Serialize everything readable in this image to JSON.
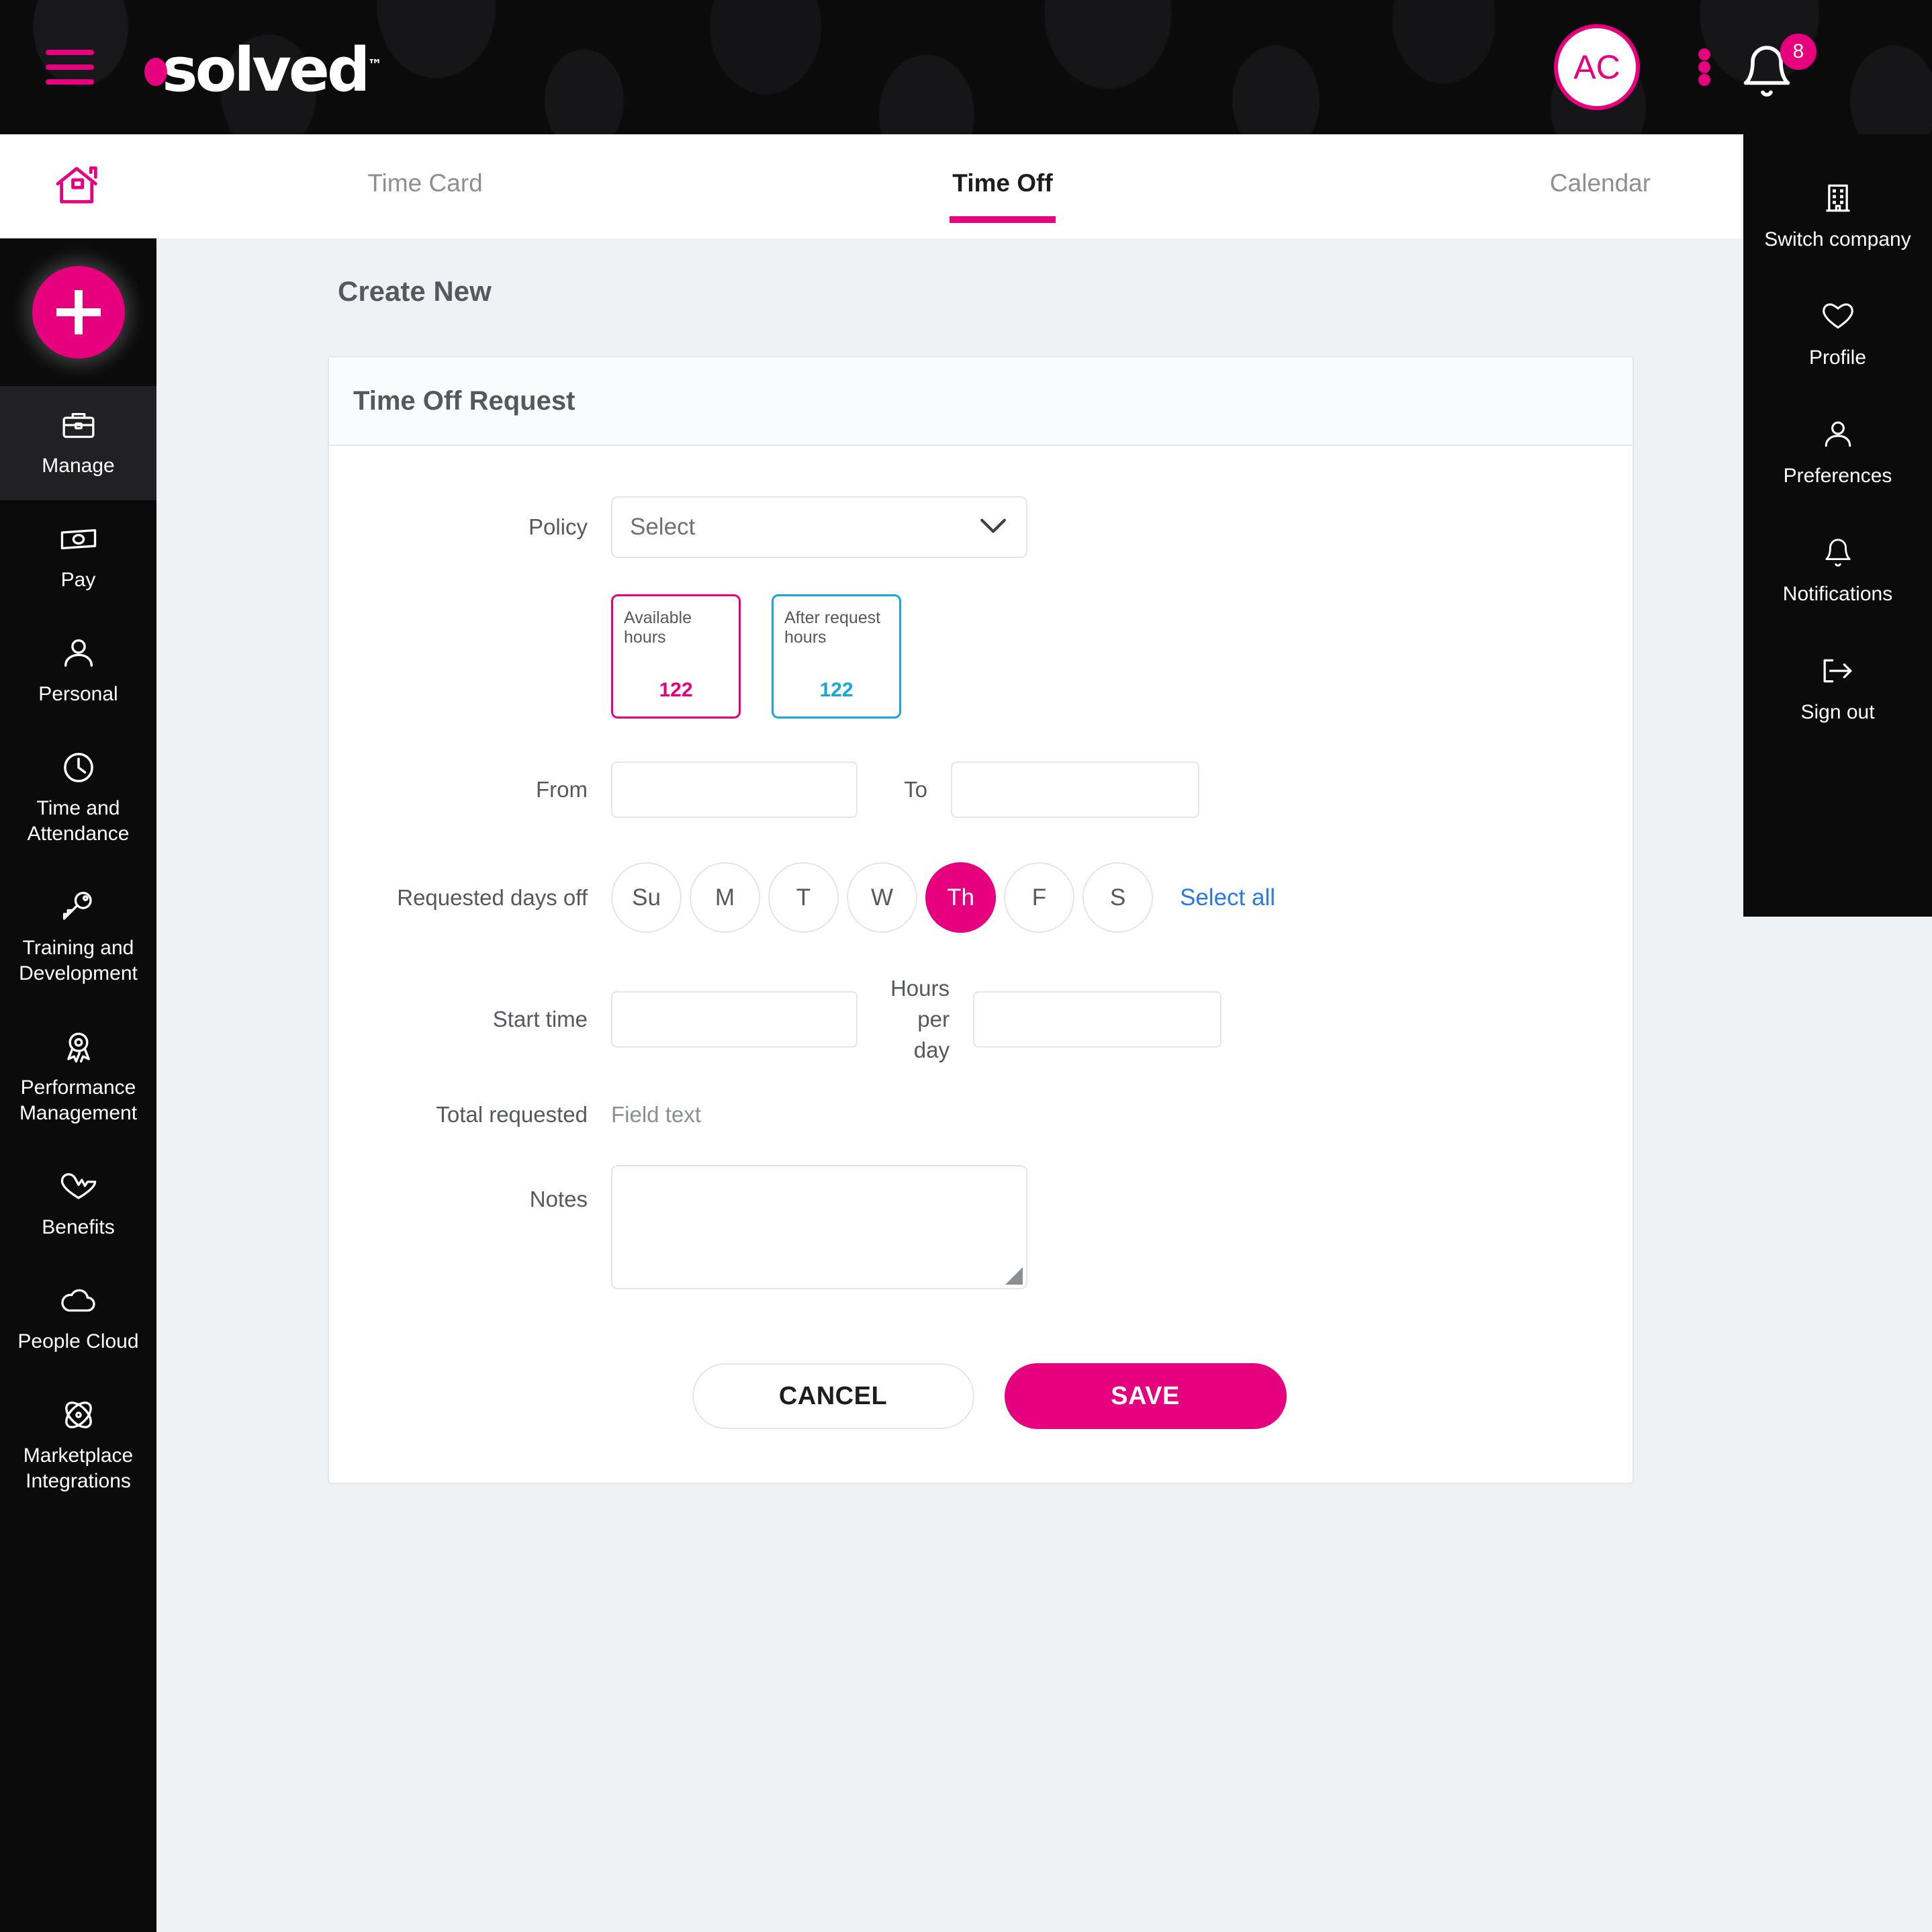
{
  "header": {
    "menu_icon": "hamburger-menu-icon",
    "logo_text": "solved",
    "logo_tm": "™",
    "avatar_initials": "AC",
    "kebab_icon": "more-vertical-icon",
    "bell_icon": "bell-icon",
    "notification_count": "8"
  },
  "sidebar": {
    "home_icon": "home-icon",
    "add_label": "+",
    "items": [
      {
        "label": "Manage",
        "icon": "briefcase-icon",
        "active": true
      },
      {
        "label": "Pay",
        "icon": "money-icon",
        "active": false
      },
      {
        "label": "Personal",
        "icon": "person-icon",
        "active": false
      },
      {
        "label": "Time and Attendance",
        "icon": "clock-icon",
        "active": false
      },
      {
        "label": "Training and Development",
        "icon": "key-icon",
        "active": false
      },
      {
        "label": "Performance Management",
        "icon": "award-ribbon-icon",
        "active": false
      },
      {
        "label": "Benefits",
        "icon": "heartbeat-icon",
        "active": false
      },
      {
        "label": "People Cloud",
        "icon": "cloud-icon",
        "active": false
      },
      {
        "label": "Marketplace Integrations",
        "icon": "atom-icon",
        "active": false
      }
    ]
  },
  "tabs": [
    {
      "label": "Time Card",
      "active": false
    },
    {
      "label": "Time Off",
      "active": true
    },
    {
      "label": "Calendar",
      "active": false
    }
  ],
  "main": {
    "page_title": "Create New",
    "card_title": "Time Off Request",
    "policy": {
      "label": "Policy",
      "selected": "Select",
      "chevron_icon": "chevron-down-icon"
    },
    "stats": [
      {
        "title": "Available hours",
        "value": "122",
        "color": "#e6007e"
      },
      {
        "title": "After request hours",
        "value": "122",
        "color": "#16a7dd"
      }
    ],
    "from": {
      "label": "From",
      "value": "",
      "placeholder": ""
    },
    "to": {
      "label": "To",
      "value": "",
      "placeholder": ""
    },
    "days_off": {
      "label": "Requested days off",
      "days": [
        {
          "label": "Su",
          "selected": false
        },
        {
          "label": "M",
          "selected": false
        },
        {
          "label": "T",
          "selected": false
        },
        {
          "label": "W",
          "selected": false
        },
        {
          "label": "Th",
          "selected": true
        },
        {
          "label": "F",
          "selected": false
        },
        {
          "label": "S",
          "selected": false
        }
      ],
      "select_all_label": "Select all"
    },
    "start_time": {
      "label": "Start time",
      "value": "",
      "placeholder": ""
    },
    "hours_per_day": {
      "label": "Hours per day",
      "value": "",
      "placeholder": ""
    },
    "total_requested": {
      "label": "Total requested",
      "value": "Field text"
    },
    "notes": {
      "label": "Notes",
      "value": "",
      "placeholder": ""
    },
    "buttons": {
      "cancel": "CANCEL",
      "save": "SAVE"
    }
  },
  "profile_menu": {
    "items": [
      {
        "label": "Switch company",
        "icon": "building-icon"
      },
      {
        "label": "Profile",
        "icon": "heart-icon"
      },
      {
        "label": "Preferences",
        "icon": "person-icon"
      },
      {
        "label": "Notifications",
        "icon": "bell-icon"
      },
      {
        "label": "Sign out",
        "icon": "sign-out-icon"
      }
    ]
  },
  "colors": {
    "brand_pink": "#e6007e",
    "accent_blue": "#16a7dd",
    "link_blue": "#2a7ae2",
    "page_bg": "#eef2f5",
    "dark": "#0b0b0c"
  }
}
